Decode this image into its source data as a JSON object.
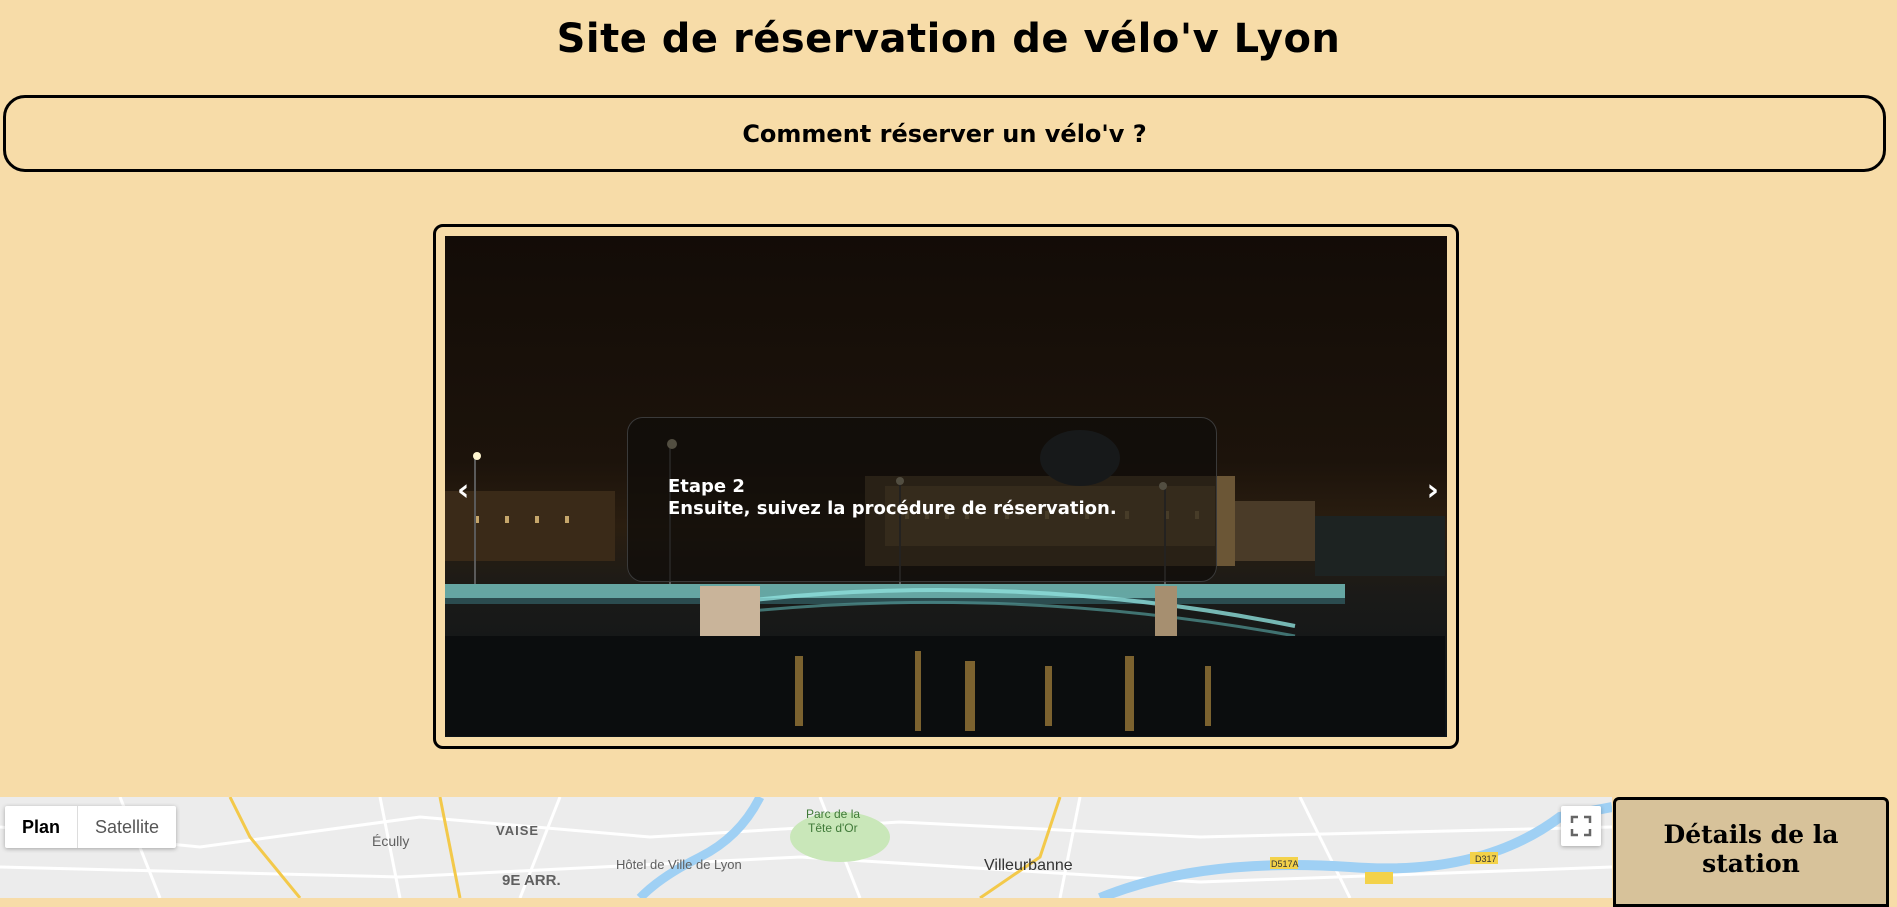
{
  "header": {
    "title": "Site de réservation de vélo'v Lyon"
  },
  "howto": {
    "label": "Comment réserver un vélo'v ?"
  },
  "slider": {
    "prev": "‹",
    "next": "›",
    "caption_title": "Etape 2",
    "caption_text": "Ensuite, suivez la procédure de réservation."
  },
  "map": {
    "type_plan": "Plan",
    "type_satellite": "Satellite",
    "labels": {
      "ecully": "Écully",
      "vaise": "VAISE",
      "arr9": "9E ARR.",
      "hotel_ville": "Hôtel de Ville de Lyon",
      "parc": "Parc de la",
      "tete_or": "Tête d'Or",
      "villeurbanne": "Villeurbanne",
      "d317": "D317",
      "d517a": "D517A"
    }
  },
  "station": {
    "title": "Détails de la station"
  },
  "colors": {
    "background": "#f7dca8",
    "station_panel": "#d7c29a"
  }
}
